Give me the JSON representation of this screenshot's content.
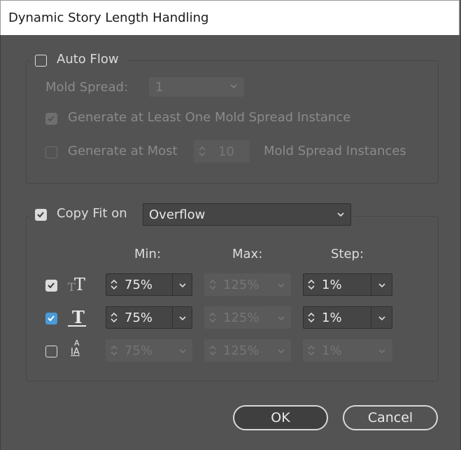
{
  "dialog": {
    "title": "Dynamic Story Length Handling"
  },
  "auto_flow": {
    "label": "Auto Flow",
    "checked": false,
    "mold_spread_label": "Mold Spread:",
    "mold_spread_value": "1",
    "generate_at_least_label": "Generate at Least One Mold Spread Instance",
    "generate_at_least_checked": true,
    "generate_at_most_label": "Generate at Most",
    "generate_at_most_value": "10",
    "generate_at_most_suffix": "Mold Spread Instances"
  },
  "copy_fit": {
    "label": "Copy Fit on",
    "checked": true,
    "mode": "Overflow",
    "headers": {
      "min": "Min:",
      "max": "Max:",
      "step": "Step:"
    },
    "rows": [
      {
        "icon": "font-size-icon",
        "checked": true,
        "min": "75%",
        "max": "125%",
        "step": "1%",
        "enabled": true
      },
      {
        "icon": "horizontal-scale-icon",
        "checked": true,
        "min": "75%",
        "max": "125%",
        "step": "1%",
        "enabled": true
      },
      {
        "icon": "leading-icon",
        "checked": false,
        "min": "75%",
        "max": "125%",
        "step": "1%",
        "enabled": false
      }
    ],
    "row3_icon_text": {
      "top": "A",
      "bottom": "IA"
    },
    "row_glyph": "T"
  },
  "buttons": {
    "ok": "OK",
    "cancel": "Cancel"
  },
  "colors": {
    "panel": "#535353",
    "accent_checkbox": "#4a9ad8"
  }
}
